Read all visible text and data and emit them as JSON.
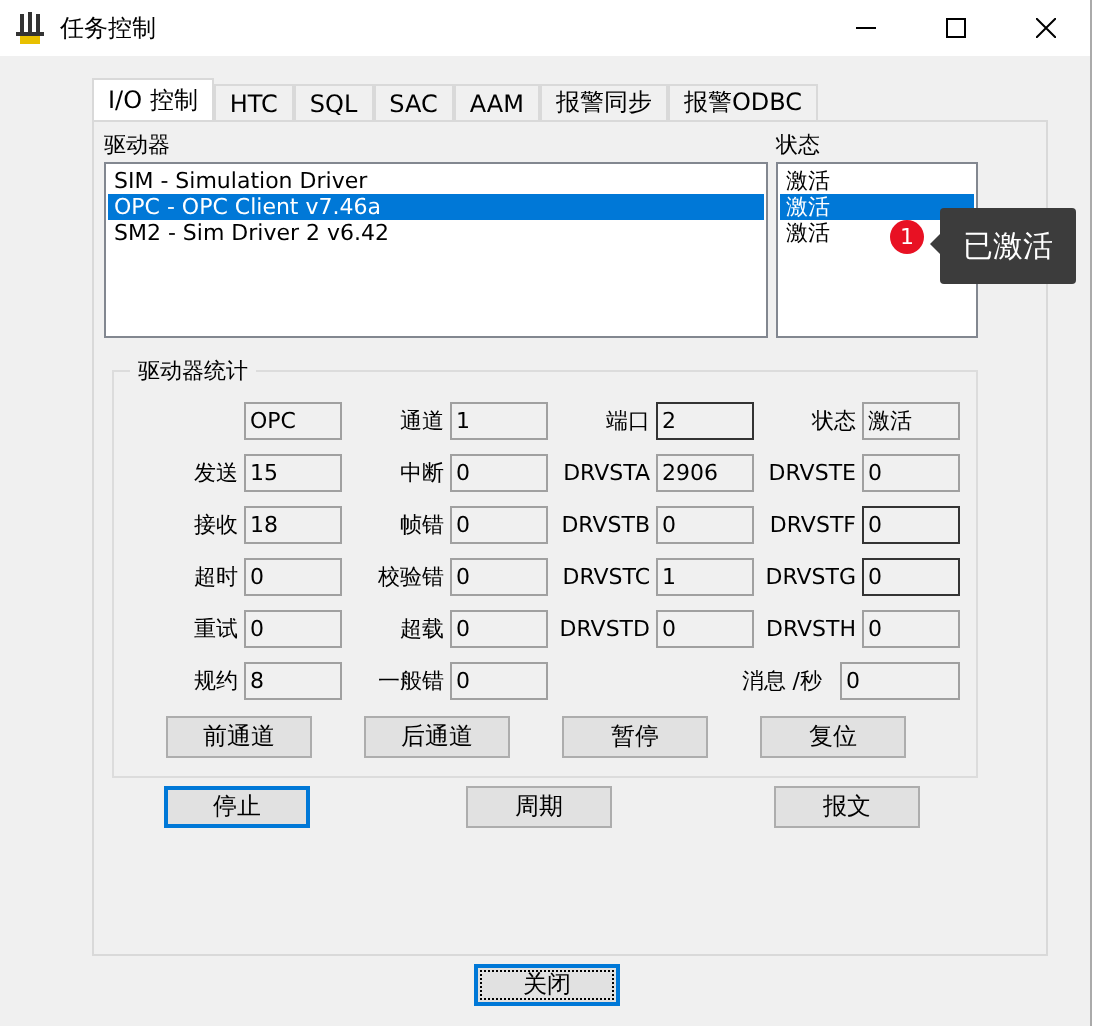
{
  "window": {
    "title": "任务控制"
  },
  "tabs": [
    {
      "label": "I/O 控制",
      "selected": true
    },
    {
      "label": "HTC",
      "selected": false
    },
    {
      "label": "SQL",
      "selected": false
    },
    {
      "label": "SAC",
      "selected": false
    },
    {
      "label": "AAM",
      "selected": false
    },
    {
      "label": "报警同步",
      "selected": false
    },
    {
      "label": "报警ODBC",
      "selected": false
    }
  ],
  "drivers": {
    "label": "驱动器",
    "items": [
      {
        "text": "SIM - Simulation Driver",
        "selected": false
      },
      {
        "text": "OPC - OPC Client v7.46a",
        "selected": true
      },
      {
        "text": "SM2 - Sim Driver 2 v6.42",
        "selected": false
      }
    ]
  },
  "status": {
    "label": "状态",
    "items": [
      {
        "text": "激活",
        "selected": false
      },
      {
        "text": "激活",
        "selected": true
      },
      {
        "text": "激活",
        "selected": false
      }
    ]
  },
  "tooltip": {
    "badge": "1",
    "text": "已激活"
  },
  "stats": {
    "title": "驱动器统计",
    "rows": [
      [
        {
          "value": "OPC",
          "emphasized": false
        },
        {
          "label": "通道",
          "value": "1",
          "emphasized": false
        },
        {
          "label": "端口",
          "value": "2",
          "emphasized": true
        },
        {
          "label": "状态",
          "value": "激活",
          "emphasized": false
        }
      ],
      [
        {
          "label": "发送",
          "value": "15",
          "emphasized": false
        },
        {
          "label": "中断",
          "value": "0",
          "emphasized": false
        },
        {
          "label": "DRVSTA",
          "value": "2906",
          "emphasized": false
        },
        {
          "label": "DRVSTE",
          "value": "0",
          "emphasized": false
        }
      ],
      [
        {
          "label": "接收",
          "value": "18",
          "emphasized": false
        },
        {
          "label": "帧错",
          "value": "0",
          "emphasized": false
        },
        {
          "label": "DRVSTB",
          "value": "0",
          "emphasized": false
        },
        {
          "label": "DRVSTF",
          "value": "0",
          "emphasized": true
        }
      ],
      [
        {
          "label": "超时",
          "value": "0",
          "emphasized": false
        },
        {
          "label": "校验错",
          "value": "0",
          "emphasized": false
        },
        {
          "label": "DRVSTC",
          "value": "1",
          "emphasized": false
        },
        {
          "label": "DRVSTG",
          "value": "0",
          "emphasized": true
        }
      ],
      [
        {
          "label": "重试",
          "value": "0",
          "emphasized": false
        },
        {
          "label": "超载",
          "value": "0",
          "emphasized": false
        },
        {
          "label": "DRVSTD",
          "value": "0",
          "emphasized": false
        },
        {
          "label": "DRVSTH",
          "value": "0",
          "emphasized": false
        }
      ],
      [
        {
          "label": "规约",
          "value": "8",
          "emphasized": false
        },
        {
          "label": "一般错",
          "value": "0",
          "emphasized": false
        },
        {
          "kind": "blank"
        },
        {
          "kind": "wide",
          "label": "消息 /秒",
          "value": "0",
          "emphasized": false
        }
      ]
    ],
    "buttons": [
      "前通道",
      "后通道",
      "暂停",
      "复位"
    ]
  },
  "buttons": [
    {
      "label": "停止",
      "focused": true
    },
    {
      "label": "周期",
      "focused": false
    },
    {
      "label": "报文",
      "focused": false
    }
  ],
  "close_button": {
    "label": "关闭",
    "focused": true
  }
}
